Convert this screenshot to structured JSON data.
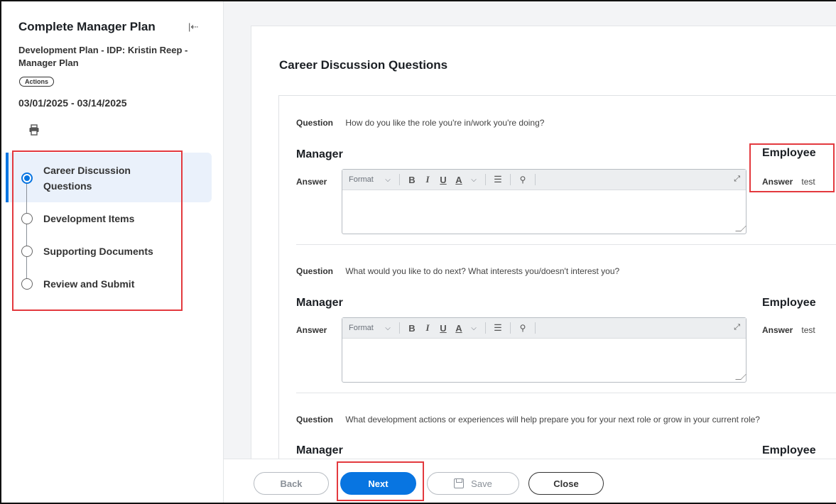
{
  "sidebar": {
    "title": "Complete Manager Plan",
    "subtitle": "Development Plan - IDP: Kristin Reep - Manager Plan",
    "actions_label": "Actions",
    "dates": "03/01/2025 - 03/14/2025",
    "steps": [
      {
        "label": "Career Discussion Questions",
        "active": true
      },
      {
        "label": "Development Items",
        "active": false
      },
      {
        "label": "Supporting Documents",
        "active": false
      },
      {
        "label": "Review and Submit",
        "active": false
      }
    ]
  },
  "main": {
    "section_title": "Career Discussion Questions",
    "question_label": "Question",
    "manager_label": "Manager",
    "employee_label": "Employee",
    "answer_label": "Answer",
    "questions": [
      {
        "text": "How do you like the role you're in/work you're doing?",
        "employee_answer": "test"
      },
      {
        "text": "What would you like to do next? What interests you/doesn't interest you?",
        "employee_answer": "test"
      },
      {
        "text": "What development actions or experiences will help prepare you for your next role or grow in your current role?"
      }
    ],
    "editor_toolbar": {
      "format": "Format",
      "bold": "B",
      "italic": "I",
      "underline": "U",
      "font_color": "A"
    }
  },
  "footer": {
    "back": "Back",
    "next": "Next",
    "save": "Save",
    "close": "Close"
  },
  "colors": {
    "accent": "#0875e1",
    "highlight": "#e3393e",
    "active_step_bg": "#eaf1fb"
  }
}
